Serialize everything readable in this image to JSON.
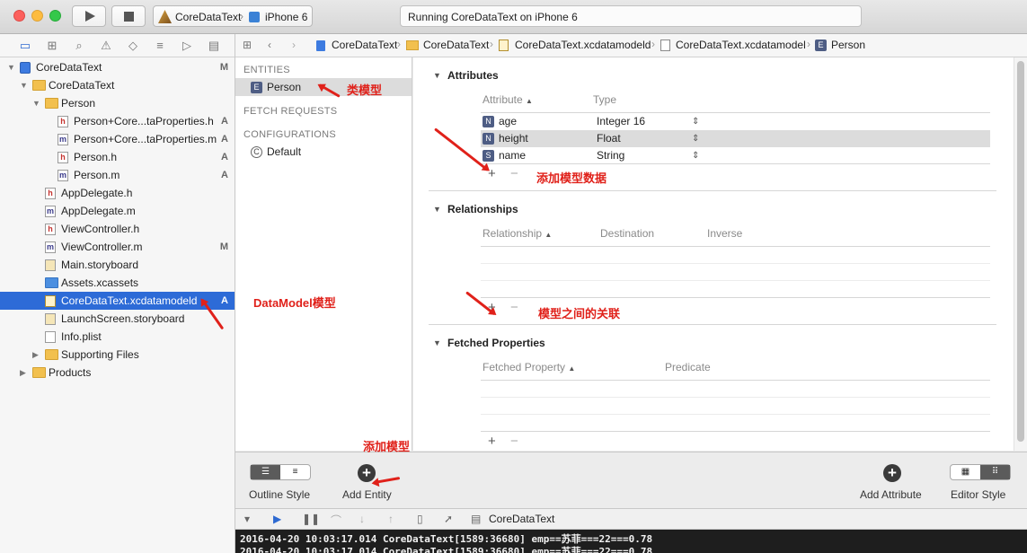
{
  "toolbar": {
    "scheme_name": "CoreDataText",
    "device_name": "iPhone 6",
    "status_text": "Running CoreDataText on iPhone 6"
  },
  "navigator": {
    "items": [
      {
        "label": "CoreDataText",
        "badge": "M",
        "indent": 0,
        "icon": "project",
        "disclosure": "open"
      },
      {
        "label": "CoreDataText",
        "badge": "",
        "indent": 1,
        "icon": "folder",
        "disclosure": "open"
      },
      {
        "label": "Person",
        "badge": "",
        "indent": 2,
        "icon": "folder",
        "disclosure": "open"
      },
      {
        "label": "Person+Core...taProperties.h",
        "badge": "A",
        "indent": 3,
        "icon": "h"
      },
      {
        "label": "Person+Core...taProperties.m",
        "badge": "A",
        "indent": 3,
        "icon": "m"
      },
      {
        "label": "Person.h",
        "badge": "A",
        "indent": 3,
        "icon": "h"
      },
      {
        "label": "Person.m",
        "badge": "A",
        "indent": 3,
        "icon": "m"
      },
      {
        "label": "AppDelegate.h",
        "badge": "",
        "indent": 2,
        "icon": "h"
      },
      {
        "label": "AppDelegate.m",
        "badge": "",
        "indent": 2,
        "icon": "m"
      },
      {
        "label": "ViewController.h",
        "badge": "",
        "indent": 2,
        "icon": "h"
      },
      {
        "label": "ViewController.m",
        "badge": "M",
        "indent": 2,
        "icon": "m"
      },
      {
        "label": "Main.storyboard",
        "badge": "",
        "indent": 2,
        "icon": "storyboard"
      },
      {
        "label": "Assets.xcassets",
        "badge": "",
        "indent": 2,
        "icon": "assets"
      },
      {
        "label": "CoreDataText.xcdatamodeld",
        "badge": "A",
        "indent": 2,
        "icon": "model",
        "selected": true
      },
      {
        "label": "LaunchScreen.storyboard",
        "badge": "",
        "indent": 2,
        "icon": "storyboard"
      },
      {
        "label": "Info.plist",
        "badge": "",
        "indent": 2,
        "icon": "plist"
      },
      {
        "label": "Supporting Files",
        "badge": "",
        "indent": 2,
        "icon": "folder",
        "disclosure": "closed"
      },
      {
        "label": "Products",
        "badge": "",
        "indent": 1,
        "icon": "folder",
        "disclosure": "closed"
      }
    ]
  },
  "jumpbar": {
    "crumbs": [
      "CoreDataText",
      "CoreDataText",
      "CoreDataText.xcdatamodeld",
      "CoreDataText.xcdatamodel",
      "Person"
    ]
  },
  "entities": {
    "entities_header": "ENTITIES",
    "entity_name": "Person",
    "entity_badge": "E",
    "fetch_header": "FETCH REQUESTS",
    "config_header": "CONFIGURATIONS",
    "config_name": "Default",
    "config_badge": "C"
  },
  "attributes": {
    "title": "Attributes",
    "col_attribute": "Attribute",
    "col_type": "Type",
    "rows": [
      {
        "badge": "N",
        "name": "age",
        "type": "Integer 16"
      },
      {
        "badge": "N",
        "name": "height",
        "type": "Float"
      },
      {
        "badge": "S",
        "name": "name",
        "type": "String"
      }
    ]
  },
  "relationships": {
    "title": "Relationships",
    "col_relationship": "Relationship",
    "col_destination": "Destination",
    "col_inverse": "Inverse"
  },
  "fetched": {
    "title": "Fetched Properties",
    "col_property": "Fetched Property",
    "col_predicate": "Predicate"
  },
  "bottombar": {
    "outline_style": "Outline Style",
    "add_entity": "Add Entity",
    "add_attribute": "Add Attribute",
    "editor_style": "Editor Style"
  },
  "debugbar": {
    "target": "CoreDataText"
  },
  "console": {
    "lines": [
      "2016-04-20 10:03:17.014 CoreDataText[1589:36680] emp==苏菲===22===0.78",
      "2016-04-20 10:03:17.014 CoreDataText[1589:36680] emp==苏菲===22===0.78"
    ]
  },
  "annotations": {
    "class_model": "类模型",
    "add_model_data": "添加模型数据",
    "datamodel_model": "DataModel模型",
    "model_relations": "模型之间的关联",
    "add_model": "添加模型"
  },
  "colors": {
    "selection_blue": "#2d6bd7",
    "annotation_red": "#e0211a",
    "entity_badge": "#4e5d84"
  }
}
